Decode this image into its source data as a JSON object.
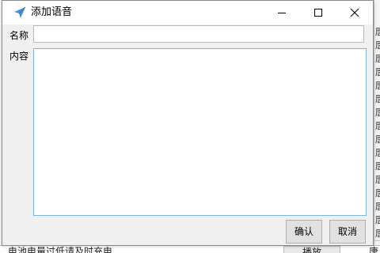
{
  "dialog": {
    "title": "添加语音",
    "title_icon": "send-arrow-icon",
    "controls": {
      "minimize_icon": "minimize-icon",
      "maximize_icon": "maximize-icon",
      "close_icon": "close-icon"
    },
    "fields": {
      "name_label": "名称",
      "name_value": "",
      "content_label": "内容",
      "content_value": ""
    },
    "buttons": {
      "ok_label": "确认",
      "cancel_label": "取消"
    }
  },
  "background": {
    "right_column_cells": [
      "唐",
      "唐",
      "唐",
      "唐",
      "唐",
      "唐",
      "唐",
      "唐",
      "唐",
      "唐",
      "唐",
      "唐",
      "唐",
      "唐",
      "唐",
      "唐"
    ],
    "bottom_row_text": "电池电量过低请及时充电",
    "bottom_row_button": "播放",
    "bottom_row_right": "唐"
  },
  "colors": {
    "titlebar_bg": "#ffffff",
    "dialog_bg": "#f0f0f0",
    "focus_border": "#7eb4ea",
    "title_icon_color": "#4a90d9"
  }
}
